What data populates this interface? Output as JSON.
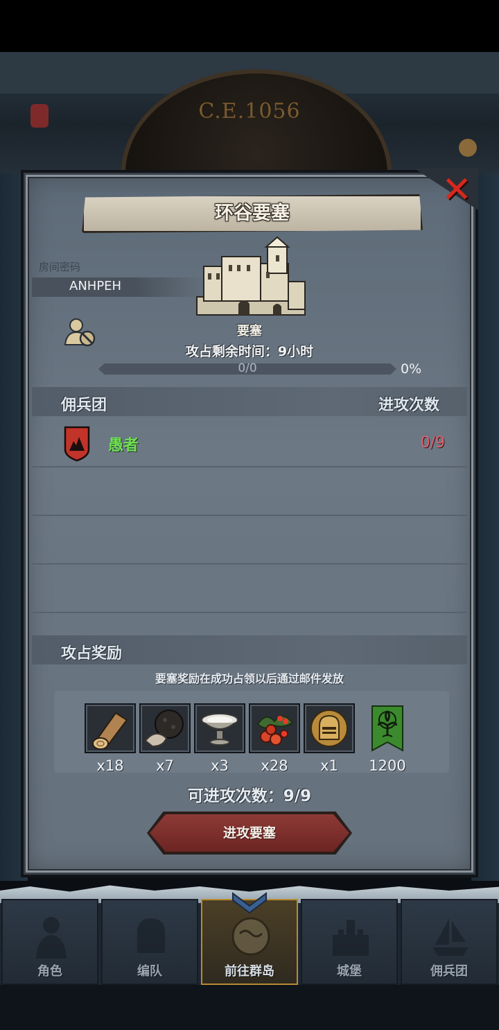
{
  "header": {
    "era": "C.E.1056"
  },
  "dialog": {
    "title": "环谷要塞",
    "room_code_label": "房间密码",
    "room_code": "ANHPEH",
    "building_type": "要塞",
    "time_label": "攻占剩余时间：",
    "time_value": "9小时",
    "progress_text": "0/0",
    "progress_percent": "0%",
    "progress_fraction": 0,
    "mercenary_header": "佣兵团",
    "attempts_header": "进攻次数",
    "mercenaries": [
      {
        "name": "愚者",
        "attempts": "0/9"
      }
    ],
    "reward_header": "攻占奖励",
    "reward_note": "要塞奖励在成功占领以后通过邮件发放",
    "rewards": [
      {
        "icon": "wood-log-icon",
        "qty": "x18"
      },
      {
        "icon": "truffle-icon",
        "qty": "x7"
      },
      {
        "icon": "silver-bowl-icon",
        "qty": "x3"
      },
      {
        "icon": "berries-icon",
        "qty": "x28"
      },
      {
        "icon": "golden-helmet-icon",
        "qty": "x1"
      },
      {
        "icon": "green-tree-banner-icon",
        "qty": "1200"
      }
    ],
    "attack_count_label": "可进攻次数：",
    "attack_count_value": "9/9",
    "attack_button": "进攻要塞",
    "colors": {
      "green_name": "#6fe055",
      "red_attempts": "#e0616e",
      "close_red": "#d8281e"
    }
  },
  "nav": {
    "items": [
      {
        "label": "角色",
        "icon": "knight-icon"
      },
      {
        "label": "编队",
        "icon": "helmet-icon"
      },
      {
        "label": "前往群岛",
        "icon": "globe-icon",
        "active": true
      },
      {
        "label": "城堡",
        "icon": "castle-icon"
      },
      {
        "label": "佣兵团",
        "icon": "ship-icon"
      }
    ]
  }
}
